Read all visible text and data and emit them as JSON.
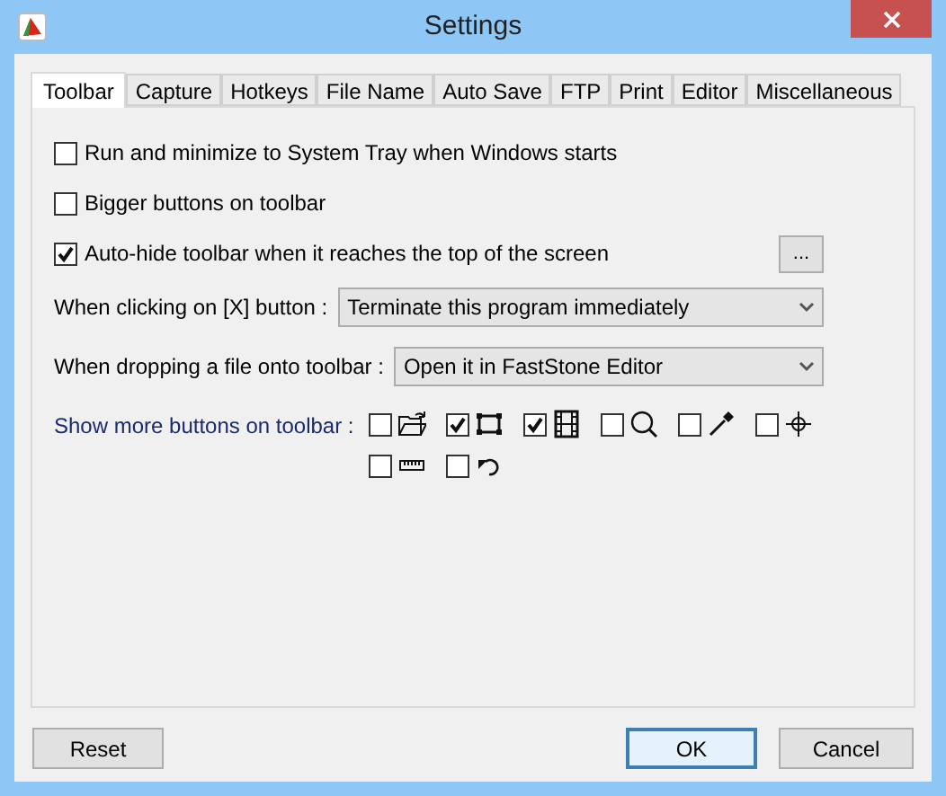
{
  "window": {
    "title": "Settings"
  },
  "tabs": [
    {
      "label": "Toolbar",
      "selected": true
    },
    {
      "label": "Capture",
      "selected": false
    },
    {
      "label": "Hotkeys",
      "selected": false
    },
    {
      "label": "File Name",
      "selected": false
    },
    {
      "label": "Auto Save",
      "selected": false
    },
    {
      "label": "FTP",
      "selected": false
    },
    {
      "label": "Print",
      "selected": false
    },
    {
      "label": "Editor",
      "selected": false
    },
    {
      "label": "Miscellaneous",
      "selected": false
    }
  ],
  "options": [
    {
      "label": "Run and minimize to System Tray when Windows starts",
      "checked": false
    },
    {
      "label": "Bigger buttons on toolbar",
      "checked": false
    },
    {
      "label": "Auto-hide toolbar when it reaches the top of the screen",
      "checked": true,
      "button": "..."
    }
  ],
  "dropdowns": [
    {
      "label": "When clicking on [X] button :",
      "value": "Terminate this program immediately"
    },
    {
      "label": "When dropping a file onto toolbar :",
      "value": "Open it in FastStone Editor"
    }
  ],
  "toolbar_buttons": {
    "label": "Show more buttons on toolbar :",
    "items": [
      {
        "kind": "folder",
        "checked": false
      },
      {
        "kind": "rectangle",
        "checked": true
      },
      {
        "kind": "film",
        "checked": true
      },
      {
        "kind": "magnifier",
        "checked": false
      },
      {
        "kind": "dropper",
        "checked": false
      },
      {
        "kind": "crosshair",
        "checked": false
      },
      {
        "kind": "ruler",
        "checked": false
      },
      {
        "kind": "undo",
        "checked": false
      }
    ]
  },
  "buttons": {
    "reset": "Reset",
    "ok": "OK",
    "cancel": "Cancel"
  }
}
